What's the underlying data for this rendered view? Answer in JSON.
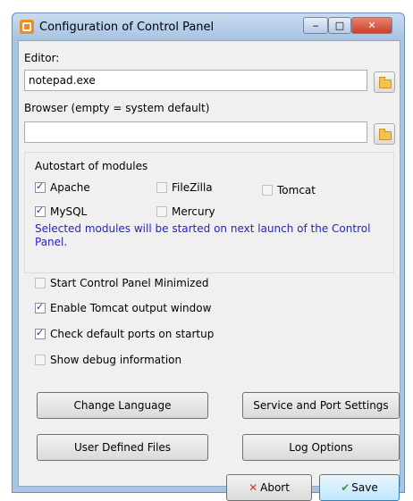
{
  "window": {
    "title": "Configuration of Control Panel",
    "controls": {
      "minimize": "‒",
      "maximize": "□",
      "close": "✕"
    }
  },
  "editor": {
    "label": "Editor:",
    "value": "notepad.exe"
  },
  "browser": {
    "label": "Browser (empty = system default)",
    "value": ""
  },
  "autostart": {
    "heading": "Autostart of modules",
    "modules": [
      {
        "label": "Apache",
        "checked": true,
        "enabled": true
      },
      {
        "label": "FileZilla",
        "checked": false,
        "enabled": false
      },
      {
        "label": "Tomcat",
        "checked": false,
        "enabled": true
      },
      {
        "label": "MySQL",
        "checked": true,
        "enabled": true
      },
      {
        "label": "Mercury",
        "checked": false,
        "enabled": false
      }
    ],
    "note": "Selected modules will be started on next launch of the Control Panel."
  },
  "options": [
    {
      "label": "Start Control Panel Minimized",
      "checked": false
    },
    {
      "label": "Enable Tomcat output window",
      "checked": true
    },
    {
      "label": "Check default ports on startup",
      "checked": true
    },
    {
      "label": "Show debug information",
      "checked": false
    }
  ],
  "buttons": {
    "change_language": "Change Language",
    "service_port_settings": "Service and Port Settings",
    "user_defined_files": "User Defined Files",
    "log_options": "Log Options",
    "abort": "Abort",
    "save": "Save"
  },
  "icons": {
    "app": "xampp-icon",
    "folder": "folder-icon",
    "abort": "x-icon",
    "save": "checkmark-icon"
  }
}
